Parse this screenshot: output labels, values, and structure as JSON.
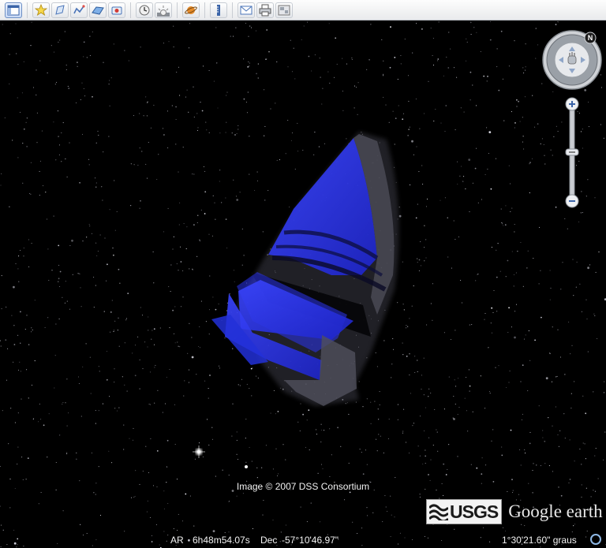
{
  "toolbar": {
    "buttons": [
      {
        "name": "sidebar-toggle-button",
        "icon": "sidebar-icon"
      },
      {
        "name": "add-placemark-button",
        "icon": "placemark-pin-icon"
      },
      {
        "name": "add-polygon-button",
        "icon": "polygon-icon"
      },
      {
        "name": "add-path-button",
        "icon": "path-icon"
      },
      {
        "name": "add-image-overlay-button",
        "icon": "image-overlay-icon"
      },
      {
        "name": "record-tour-button",
        "icon": "record-tour-icon"
      },
      {
        "name": "historical-imagery-button",
        "icon": "clock-icon"
      },
      {
        "name": "sunlight-button",
        "icon": "sun-icon"
      },
      {
        "name": "planets-button",
        "icon": "planet-icon"
      },
      {
        "name": "ruler-button",
        "icon": "ruler-icon"
      },
      {
        "name": "email-button",
        "icon": "email-icon"
      },
      {
        "name": "print-button",
        "icon": "print-icon"
      },
      {
        "name": "view-in-maps-button",
        "icon": "maps-icon"
      }
    ]
  },
  "viewport": {
    "credit": "Image © 2007 DSS Consortium",
    "logo_usgs": "USGS",
    "logo_google_earth": "Google earth",
    "compass_label": "N"
  },
  "statusbar": {
    "ra_label": "AR",
    "ra_value": "6h48m54.07s",
    "dec_label": "Dec",
    "dec_value": "-57°10'46.97\"",
    "eye_altitude": "1°30'21.60\" graus"
  },
  "colors": {
    "sky": "#000000",
    "survey_blue": "#2a36ff",
    "survey_gray": "#3f3f4a"
  }
}
